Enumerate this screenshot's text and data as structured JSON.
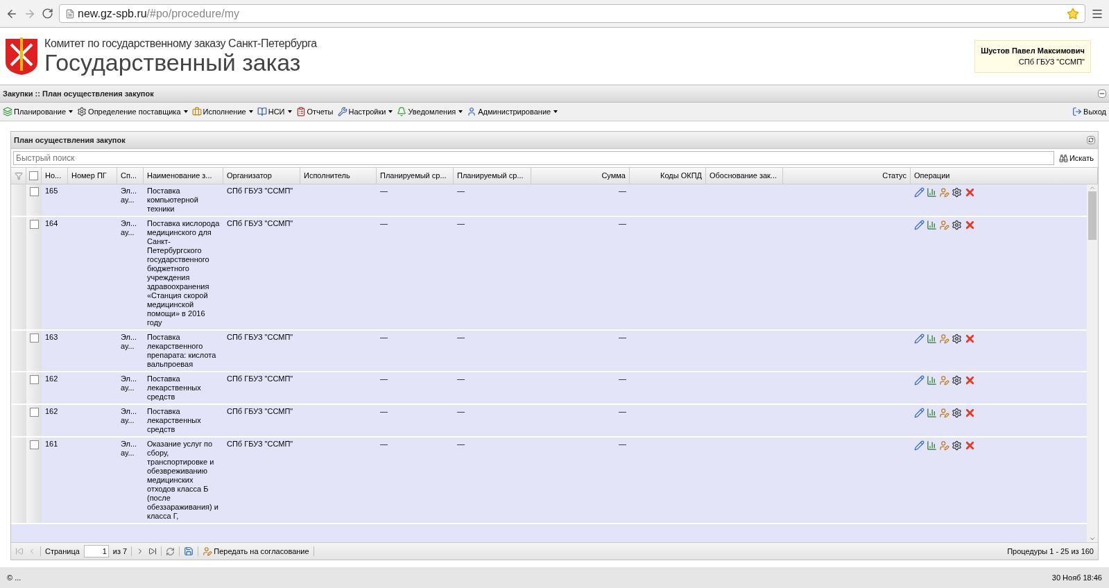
{
  "browser": {
    "url_host": "new.gz-spb.ru",
    "url_path": "/#po/procedure/my"
  },
  "header": {
    "org": "Комитет по государственному заказу Санкт-Петербурга",
    "title": "Государственный заказ",
    "user": {
      "name": "Шустов Павел Максимович",
      "org": "СПб ГБУЗ \"ССМП\""
    }
  },
  "breadcrumb": "Закупки :: План осуществления закупок",
  "menu": [
    {
      "label": "Планирование",
      "dropdown": true
    },
    {
      "label": "Определение поставщика",
      "dropdown": true
    },
    {
      "label": "Исполнение",
      "dropdown": true
    },
    {
      "label": "НСИ",
      "dropdown": true
    },
    {
      "label": "Отчеты",
      "dropdown": false
    },
    {
      "label": "Настройки",
      "dropdown": true
    },
    {
      "label": "Уведомления",
      "dropdown": true
    },
    {
      "label": "Администрирование",
      "dropdown": true
    }
  ],
  "logout": "Выход",
  "panel": {
    "title": "План осуществления закупок",
    "search": {
      "placeholder": "Быстрый поиск",
      "button": "Искать"
    },
    "header_checked": false,
    "columns": [
      "Но...",
      "Номер ПГ",
      "Сп...",
      "Наименование з...",
      "Организатор",
      "Исполнитель",
      "Планируемый ср...",
      "Планируемый ср...",
      "Сумма",
      "Коды ОКПД",
      "Обоснование зак...",
      "Статус",
      "Операции"
    ],
    "rows": [
      {
        "checked": false,
        "number": "165",
        "type": "Эл... ау...",
        "name": "Поставка компьютерной техники",
        "organizer": "СПб ГБУЗ \"ССМП\"",
        "plan_1": "—",
        "plan_2": "—",
        "sum": "—"
      },
      {
        "checked": false,
        "number": "164",
        "type": "Эл... ау...",
        "name": "Поставка кислорода медицинского для Санкт-Петербургского государственного бюджетного учреждения здравоохранения «Станция скорой медицинской помощи» в 2016 году",
        "organizer": "СПб ГБУЗ \"ССМП\"",
        "plan_1": "—",
        "plan_2": "—",
        "sum": "—"
      },
      {
        "checked": false,
        "number": "163",
        "type": "Эл... ау...",
        "name": "Поставка лекарственного препарата: кислота вальпроевая",
        "organizer": "СПб ГБУЗ \"ССМП\"",
        "plan_1": "—",
        "plan_2": "—",
        "sum": "—"
      },
      {
        "checked": false,
        "number": "162",
        "type": "Эл... ау...",
        "name": "Поставка лекарственных средств",
        "organizer": "СПб ГБУЗ \"ССМП\"",
        "plan_1": "—",
        "plan_2": "—",
        "sum": "—"
      },
      {
        "checked": false,
        "number": "162",
        "type": "Эл... ау...",
        "name": "Поставка лекарственных средств",
        "organizer": "СПб ГБУЗ \"ССМП\"",
        "plan_1": "—",
        "plan_2": "—",
        "sum": "—"
      },
      {
        "checked": false,
        "number": "161",
        "type": "Эл... ау...",
        "name": "Оказание услуг по сбору, транспортировке и обезвреживанию медицинских отходов класса Б (после обеззараживания) и класса Г,",
        "organizer": "СПб ГБУЗ \"ССМП\"",
        "plan_1": "—",
        "plan_2": "—",
        "sum": "—"
      }
    ],
    "paging": {
      "page_label": "Страница",
      "page": "1",
      "of": "из 7",
      "send": "Передать на согласование",
      "summary": "Процедуры 1 - 25 из 160"
    }
  },
  "status_bar": {
    "left": "© ...",
    "right": "30 Нояб 18:46"
  }
}
